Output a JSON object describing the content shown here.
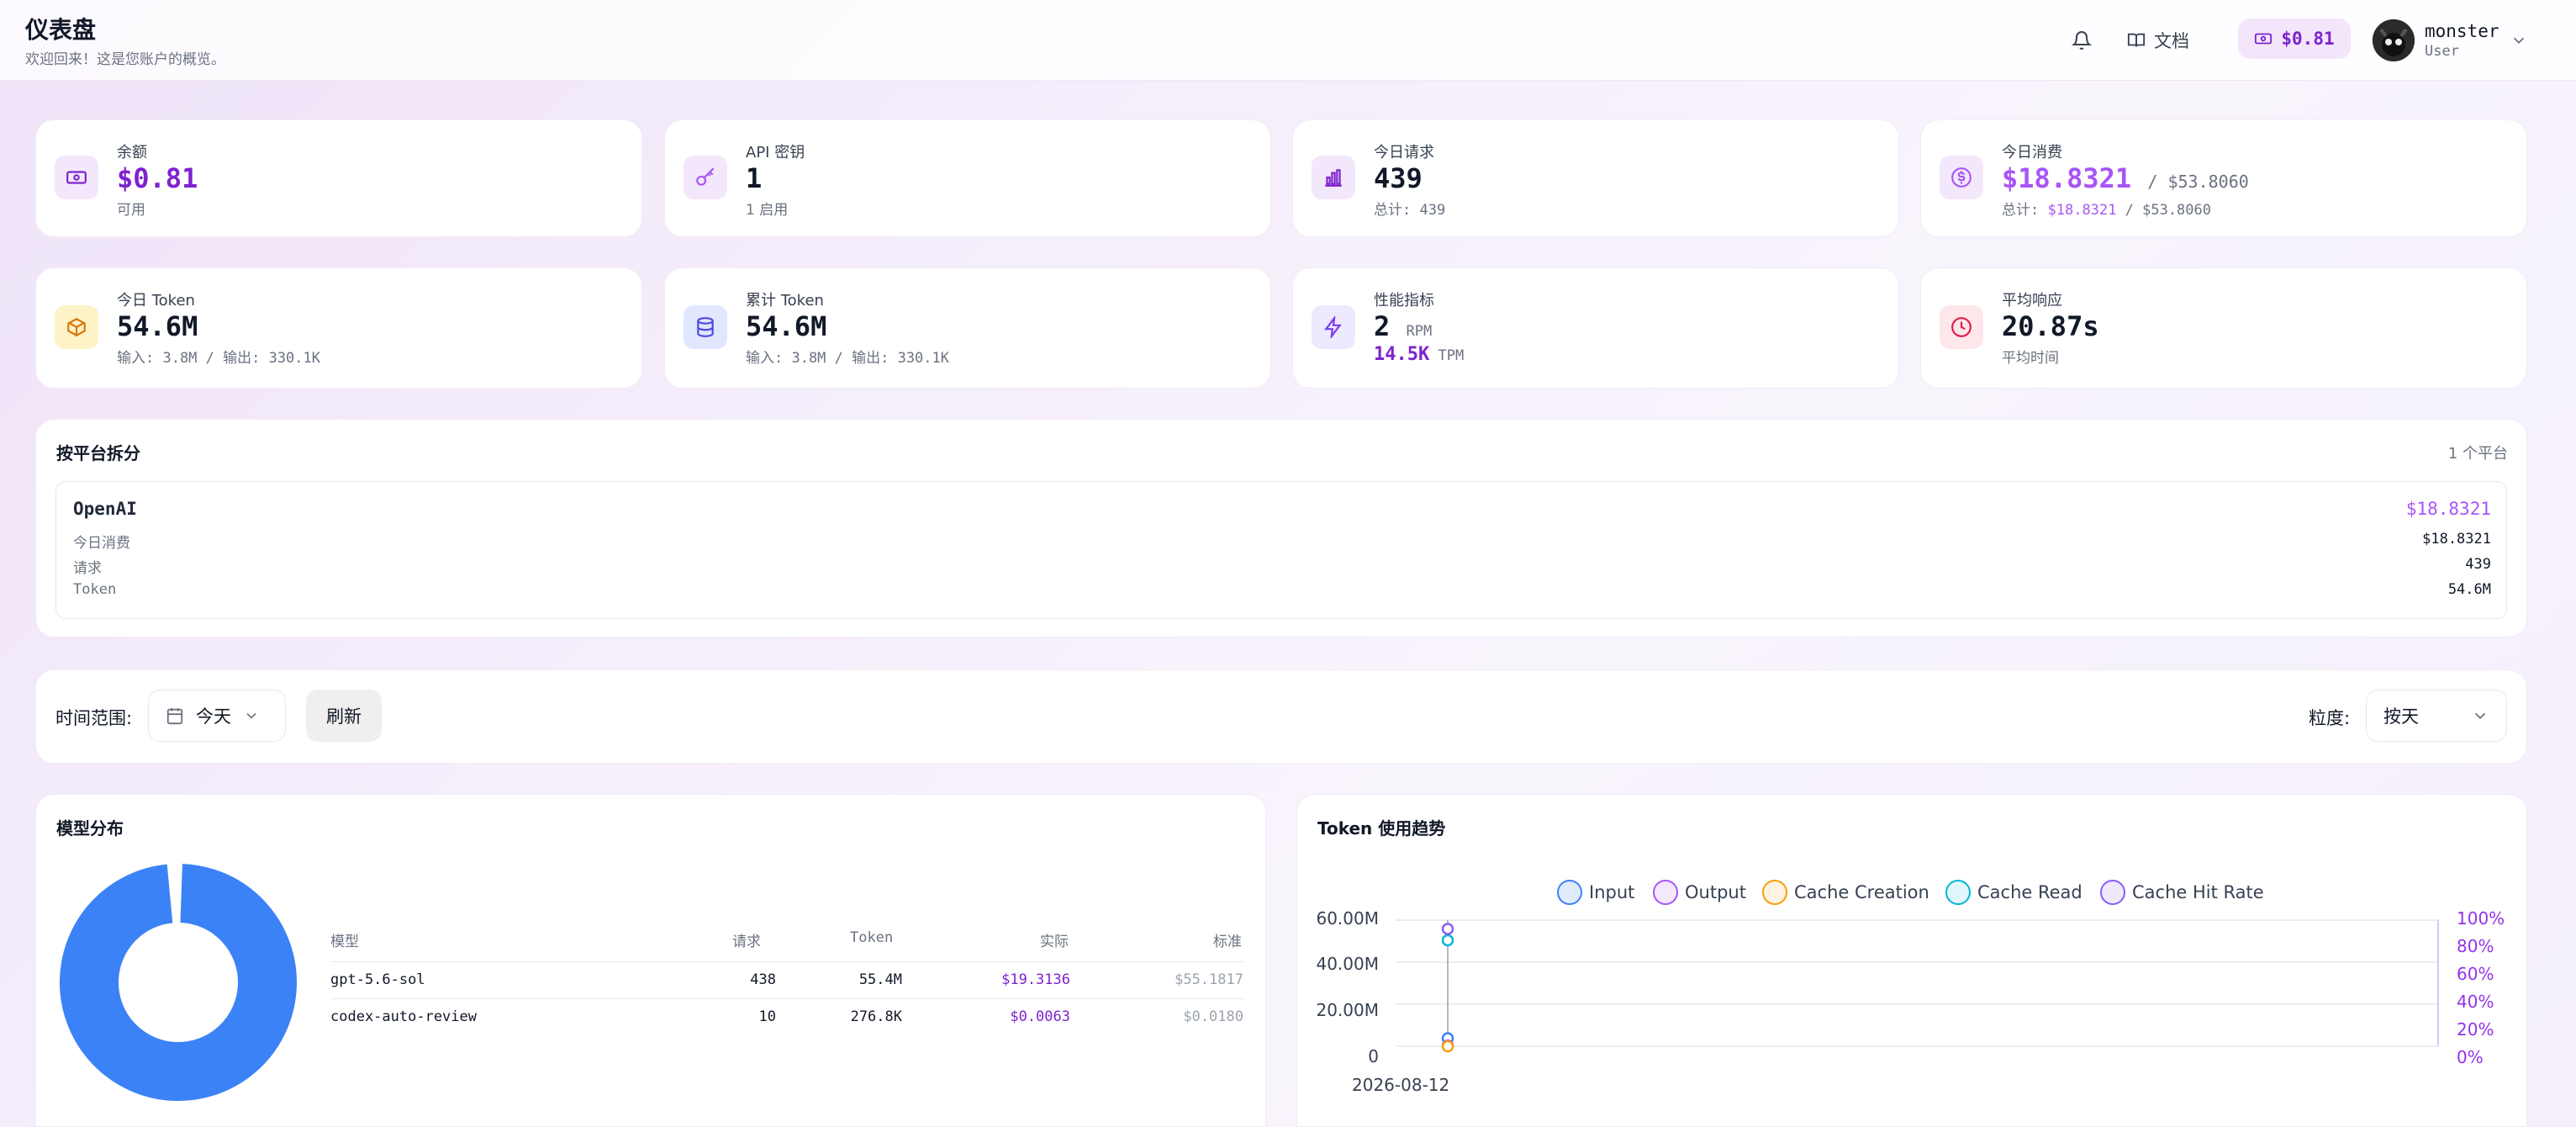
{
  "header": {
    "title": "仪表盘",
    "subtitle": "欢迎回来！这是您账户的概览。",
    "docs_label": "文档",
    "balance": "$0.81",
    "user_name": "monster",
    "user_role": "User"
  },
  "stats": {
    "balance": {
      "label": "余额",
      "value": "$0.81",
      "sub": "可用"
    },
    "api_keys": {
      "label": "API 密钥",
      "value": "1",
      "sub": "1 启用"
    },
    "requests_today": {
      "label": "今日请求",
      "value": "439",
      "sub": "总计: 439"
    },
    "spend_today": {
      "label": "今日消费",
      "value": "$18.8321",
      "value_total": "/ $53.8060",
      "sub_prefix": "总计:",
      "sub_value": "$18.8321",
      "sub_total": "/ $53.8060"
    },
    "tokens_today": {
      "label": "今日 Token",
      "value": "54.6M",
      "sub": "输入: 3.8M / 输出: 330.1K"
    },
    "tokens_total": {
      "label": "累计 Token",
      "value": "54.6M",
      "sub": "输入: 3.8M / 输出: 330.1K"
    },
    "performance": {
      "label": "性能指标",
      "rpm_value": "2",
      "rpm_unit": "RPM",
      "tpm_value": "14.5K",
      "tpm_unit": "TPM"
    },
    "avg_response": {
      "label": "平均响应",
      "value": "20.87s",
      "sub": "平均时间"
    }
  },
  "platform": {
    "title": "按平台拆分",
    "count": "1 个平台",
    "name": "OpenAI",
    "cost": "$18.8321",
    "rows": [
      {
        "label": "今日消费",
        "value": "$18.8321"
      },
      {
        "label": "请求",
        "value": "439"
      },
      {
        "label": "Token",
        "value": "54.6M"
      }
    ]
  },
  "filters": {
    "range_label": "时间范围:",
    "range_value": "今天",
    "refresh_label": "刷新",
    "granularity_label": "粒度:",
    "granularity_value": "按天"
  },
  "model_dist": {
    "title": "模型分布",
    "headers": [
      "模型",
      "请求",
      "Token",
      "实际",
      "标准"
    ],
    "rows": [
      [
        "gpt-5.6-sol",
        "438",
        "55.4M",
        "$19.3136",
        "$55.1817"
      ],
      [
        "codex-auto-review",
        "10",
        "276.8K",
        "$0.0063",
        "$0.0180"
      ]
    ],
    "pie_color": "#3b82f6"
  },
  "token_trend": {
    "title": "Token 使用趋势",
    "legend": [
      {
        "name": "Input",
        "color": "#3b82f6"
      },
      {
        "name": "Output",
        "color": "#a855f7"
      },
      {
        "name": "Cache Creation",
        "color": "#f59e0b"
      },
      {
        "name": "Cache Read",
        "color": "#06b6d4"
      },
      {
        "name": "Cache Hit Rate",
        "color": "#8b5cf6"
      }
    ],
    "y_left": [
      "60.00M",
      "40.00M",
      "20.00M",
      "0"
    ],
    "y_right": [
      "100%",
      "80%",
      "60%",
      "40%",
      "20%",
      "0%"
    ],
    "x_label": "2026-08-12"
  },
  "chart_data": {
    "type": "line",
    "x": [
      "2026-08-12"
    ],
    "series": [
      {
        "name": "Input",
        "values": [
          3800000
        ]
      },
      {
        "name": "Output",
        "values": [
          330100
        ]
      },
      {
        "name": "Cache Creation",
        "values": [
          0
        ]
      },
      {
        "name": "Cache Read",
        "values": [
          50400000
        ]
      },
      {
        "name": "Cache Hit Rate",
        "values": [
          93
        ]
      }
    ],
    "ylim": [
      0,
      60000000
    ],
    "y2lim": [
      0,
      100
    ]
  }
}
